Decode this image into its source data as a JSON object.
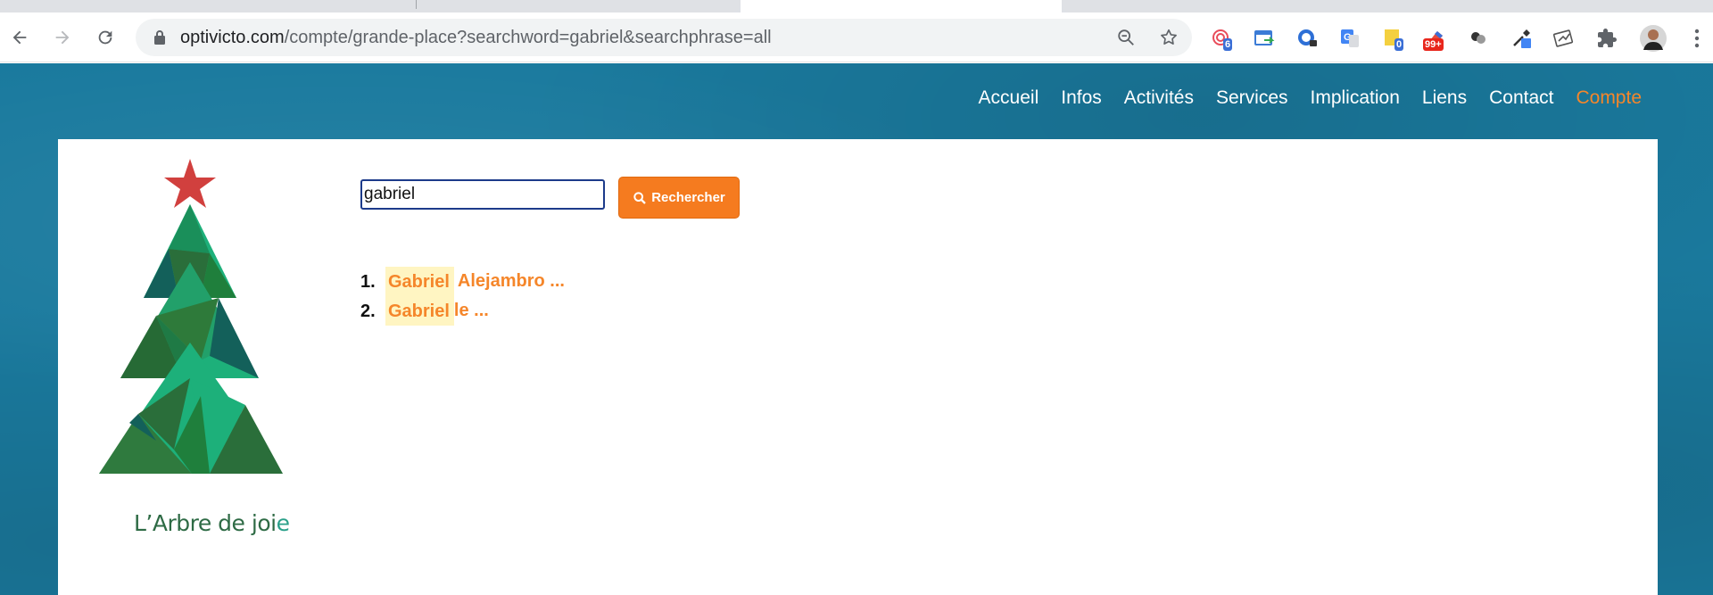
{
  "browser": {
    "url_domain": "optivicto.com",
    "url_path": "/compte/grande-place?searchword=gabriel&searchphrase=all",
    "extension_badges": {
      "ext1": "6",
      "ext5": "0",
      "ext6": "99+"
    }
  },
  "nav": {
    "items": [
      {
        "label": "Accueil"
      },
      {
        "label": "Infos"
      },
      {
        "label": "Activités"
      },
      {
        "label": "Services"
      },
      {
        "label": "Implication"
      },
      {
        "label": "Liens"
      },
      {
        "label": "Contact"
      },
      {
        "label": "Compte",
        "active": true
      }
    ]
  },
  "logo": {
    "text_main": "L’Arbre de joi",
    "text_end": "e"
  },
  "search": {
    "value": "gabriel",
    "button_label": "Rechercher"
  },
  "results": [
    {
      "num": "1.",
      "highlight": "Gabriel",
      "rest": "Alejambro ..."
    },
    {
      "num": "2.",
      "highlight": "Gabriel",
      "rest": "le ..."
    }
  ],
  "colors": {
    "accent": "#f5862a",
    "page_bg": "#1a7a9e",
    "highlight_bg": "#fff5c2"
  }
}
